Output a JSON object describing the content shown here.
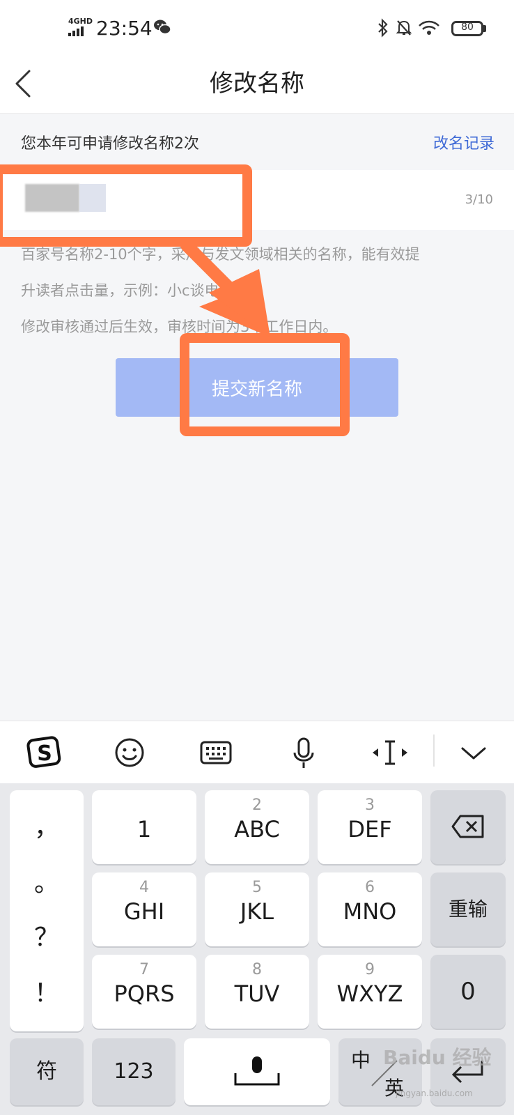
{
  "status_bar": {
    "network": "4GHD",
    "time": "23:54",
    "battery": "80",
    "icons": [
      "signal-icon",
      "wechat-icon",
      "bluetooth-icon",
      "mute-bell-icon",
      "wifi-icon",
      "battery-icon"
    ]
  },
  "nav": {
    "title": "修改名称",
    "back_icon": "chevron-left-icon"
  },
  "quota": {
    "text": "您本年可申请修改名称2次",
    "history_link": "改名记录"
  },
  "name_input": {
    "value": "",
    "counter": "3/10"
  },
  "hints": {
    "line1": "百家号名称2-10个字，采用与发文领域相关的名称，能有效提",
    "line2": "升读者点击量，示例：小c谈电影。",
    "line3": "修改审核通过后生效，审核时间为3个工作日内。"
  },
  "submit_button": "提交新名称",
  "keyboard_toolbar": {
    "items": [
      "sogou-logo-icon",
      "emoji-icon",
      "keyboard-icon",
      "microphone-icon",
      "cursor-move-icon",
      "collapse-chevron-icon"
    ]
  },
  "keyboard": {
    "punctuation": [
      "，",
      "。",
      "？",
      "！"
    ],
    "row1": [
      {
        "num": "",
        "letters": "1"
      },
      {
        "num": "2",
        "letters": "ABC"
      },
      {
        "num": "3",
        "letters": "DEF"
      }
    ],
    "row2": [
      {
        "num": "4",
        "letters": "GHI"
      },
      {
        "num": "5",
        "letters": "JKL"
      },
      {
        "num": "6",
        "letters": "MNO"
      }
    ],
    "row3": [
      {
        "num": "7",
        "letters": "PQRS"
      },
      {
        "num": "8",
        "letters": "TUV"
      },
      {
        "num": "9",
        "letters": "WXYZ"
      }
    ],
    "retype": "重输",
    "zero": "0",
    "symbols": "符",
    "numbers": "123",
    "lang_zh": "中",
    "lang_en": "英"
  },
  "colors": {
    "accent": "#3f6ad6",
    "button": "#a3b9f5",
    "annotation": "#ff7a45"
  },
  "watermark": {
    "text": "Baidu 经验",
    "sub": "jingyan.baidu.com"
  }
}
